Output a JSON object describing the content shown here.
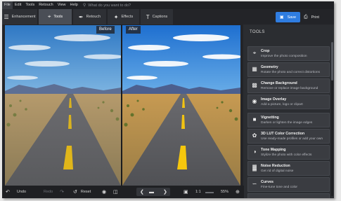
{
  "menubar": {
    "items": [
      "File",
      "Edit",
      "Tools",
      "Retouch",
      "View",
      "Help"
    ],
    "search_placeholder": "What do you want to do?"
  },
  "toolbar": {
    "tabs": [
      {
        "label": "Enhancement",
        "icon": "sliders-icon"
      },
      {
        "label": "Tools",
        "icon": "crop-icon"
      },
      {
        "label": "Retouch",
        "icon": "brush-icon"
      },
      {
        "label": "Effects",
        "icon": "magic-wand-icon"
      },
      {
        "label": "Captions",
        "icon": "text-icon"
      }
    ],
    "active_tab": "Tools",
    "save_label": "Save",
    "print_label": "Print"
  },
  "canvas": {
    "before_label": "Before",
    "after_label": "After"
  },
  "panel": {
    "title": "TOOLS",
    "tools": [
      {
        "name": "Crop",
        "desc": "Improve the photo composition",
        "icon": "crop-icon"
      },
      {
        "name": "Geometry",
        "desc": "Rotate the photo and correct distortions",
        "icon": "geometry-icon"
      },
      {
        "name": "Change Background",
        "desc": "Remove or replace image background",
        "icon": "background-icon"
      },
      {
        "name": "Image Overlay",
        "desc": "Add a picture, logo or clipart",
        "icon": "overlay-icon"
      },
      {
        "name": "Vignetting",
        "desc": "Darken or lighten the image edges",
        "icon": "vignette-icon"
      },
      {
        "name": "3D LUT Color Correction",
        "desc": "Use ready-made profiles or add your own",
        "icon": "lut-icon"
      },
      {
        "name": "Tone Mapping",
        "desc": "Stylize the photo with color effects",
        "icon": "tone-icon"
      },
      {
        "name": "Noise Reduction",
        "desc": "Get rid of digital noise",
        "icon": "noise-icon"
      },
      {
        "name": "Curves",
        "desc": "Fine-tune tone and color",
        "icon": "curves-icon"
      }
    ]
  },
  "bottombar": {
    "undo_label": "Undo",
    "redo_label": "Redo",
    "reset_label": "Reset",
    "zoom_ratio": "1:1",
    "zoom_percent": "55%"
  },
  "colors": {
    "accent": "#2f7de1",
    "background": "#2b2d31",
    "active_tab": "#4a4e56"
  }
}
